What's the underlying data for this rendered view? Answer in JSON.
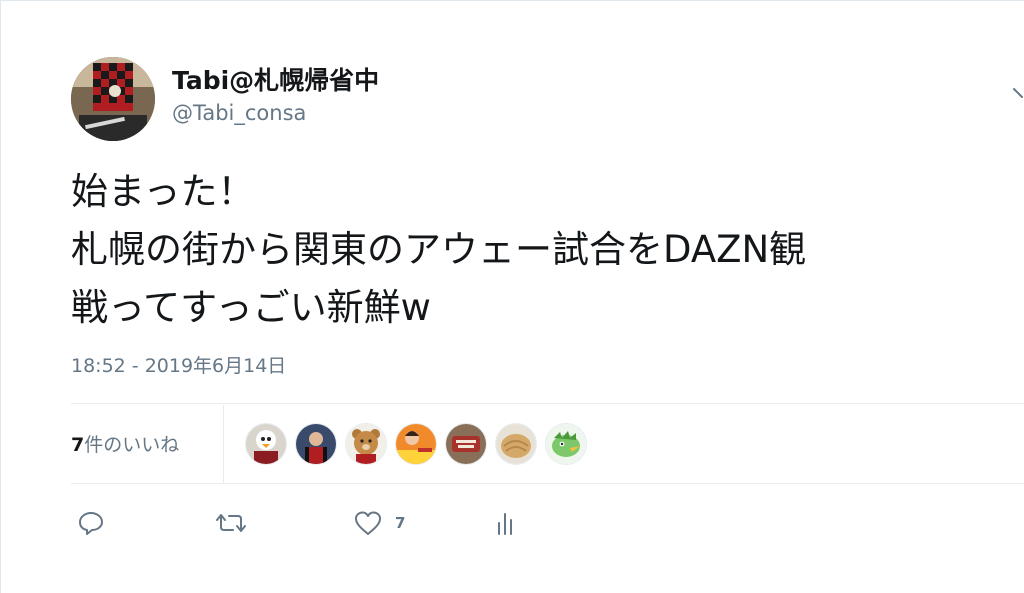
{
  "tweet": {
    "display_name": "Tabi@札幌帰省中",
    "handle": "@Tabi_consa",
    "text_lines": [
      "始まった！",
      "札幌の街から関東のアウェー試合をDAZN観",
      "戦ってすっごい新鮮w"
    ],
    "timestamp": "18:52 - 2019年6月14日"
  },
  "likes": {
    "count": "7",
    "label": "件のいいね",
    "liker_avatars": [
      "liker-avatar-1",
      "liker-avatar-2",
      "liker-avatar-3",
      "liker-avatar-4",
      "liker-avatar-5",
      "liker-avatar-6",
      "liker-avatar-7"
    ]
  },
  "actions": {
    "reply_icon": "reply-icon",
    "retweet_icon": "retweet-icon",
    "like_icon": "heart-icon",
    "like_count": "7",
    "analytics_icon": "analytics-icon"
  },
  "colors": {
    "text_primary": "#14171a",
    "text_secondary": "#657786",
    "divider": "#e6ecf0"
  }
}
